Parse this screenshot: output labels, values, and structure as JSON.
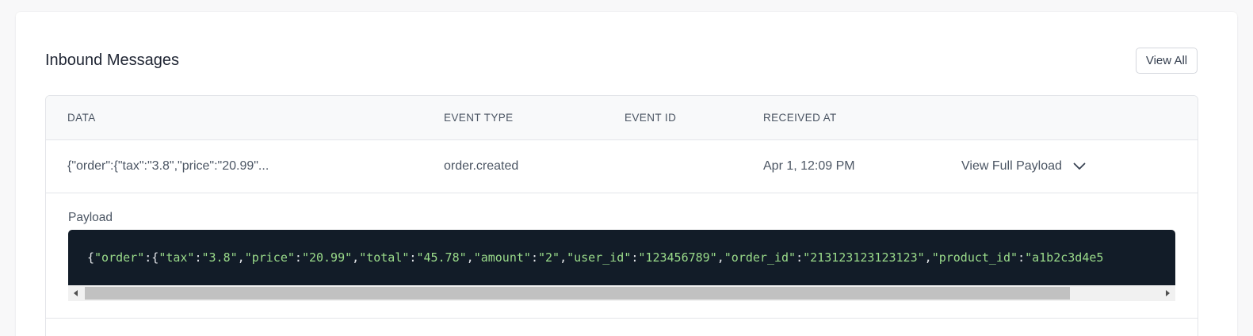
{
  "card": {
    "title": "Inbound Messages",
    "view_all_label": "View All"
  },
  "table": {
    "headers": [
      "DATA",
      "EVENT TYPE",
      "EVENT ID",
      "RECEIVED AT"
    ],
    "rows": [
      {
        "data": "{\"order\":{\"tax\":\"3.8\",\"price\":\"20.99\"...",
        "event_type": "order.created",
        "event_id": "",
        "received_at": "Apr 1, 12:09 PM",
        "action_label": "View Full Payload"
      }
    ]
  },
  "payload": {
    "label": "Payload",
    "tokens": [
      {
        "t": "p",
        "s": "{"
      },
      {
        "t": "k",
        "s": "\"order\""
      },
      {
        "t": "p",
        "s": ":{"
      },
      {
        "t": "k",
        "s": "\"tax\""
      },
      {
        "t": "p",
        "s": ":"
      },
      {
        "t": "v",
        "s": "\"3.8\""
      },
      {
        "t": "p",
        "s": ","
      },
      {
        "t": "k",
        "s": "\"price\""
      },
      {
        "t": "p",
        "s": ":"
      },
      {
        "t": "v",
        "s": "\"20.99\""
      },
      {
        "t": "p",
        "s": ","
      },
      {
        "t": "k",
        "s": "\"total\""
      },
      {
        "t": "p",
        "s": ":"
      },
      {
        "t": "v",
        "s": "\"45.78\""
      },
      {
        "t": "p",
        "s": ","
      },
      {
        "t": "k",
        "s": "\"amount\""
      },
      {
        "t": "p",
        "s": ":"
      },
      {
        "t": "v",
        "s": "\"2\""
      },
      {
        "t": "p",
        "s": ","
      },
      {
        "t": "k",
        "s": "\"user_id\""
      },
      {
        "t": "p",
        "s": ":"
      },
      {
        "t": "v",
        "s": "\"123456789\""
      },
      {
        "t": "p",
        "s": ","
      },
      {
        "t": "k",
        "s": "\"order_id\""
      },
      {
        "t": "p",
        "s": ":"
      },
      {
        "t": "v",
        "s": "\"213123123123123\""
      },
      {
        "t": "p",
        "s": ","
      },
      {
        "t": "k",
        "s": "\"product_id\""
      },
      {
        "t": "p",
        "s": ":"
      },
      {
        "t": "v",
        "s": "\"a1b2c3d4e5"
      }
    ]
  },
  "icons": {
    "expand": "chevron-down-icon",
    "scroll_left": "triangle-left-icon",
    "scroll_right": "triangle-right-icon"
  },
  "colors": {
    "code_bg": "#121c28",
    "code_string": "#9adb8a",
    "code_punct": "#e5e7eb"
  }
}
